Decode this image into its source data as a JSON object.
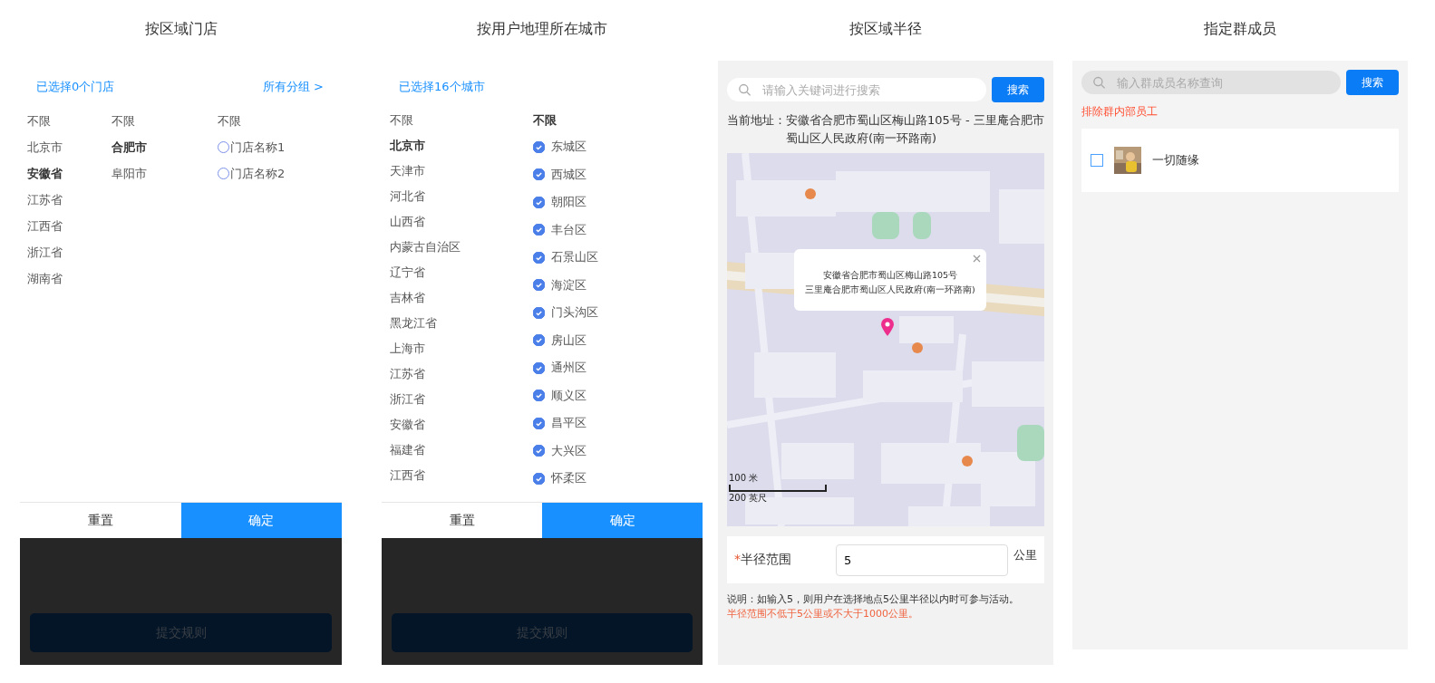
{
  "panels": [
    {
      "title": "按区域门店",
      "kind": "store",
      "selected_text": "已选择0个门店",
      "group_link": "所有分组 >",
      "columns": [
        {
          "items": [
            {
              "label": "不限",
              "selected": false
            },
            {
              "label": "北京市",
              "selected": false
            },
            {
              "label": "安徽省",
              "selected": true
            },
            {
              "label": "江苏省",
              "selected": false
            },
            {
              "label": "江西省",
              "selected": false
            },
            {
              "label": "浙江省",
              "selected": false
            },
            {
              "label": "湖南省",
              "selected": false
            }
          ]
        },
        {
          "items": [
            {
              "label": "不限",
              "selected": false
            },
            {
              "label": "合肥市",
              "selected": true
            },
            {
              "label": "阜阳市",
              "selected": false
            }
          ]
        }
      ],
      "stores": {
        "header": "不限",
        "items": [
          {
            "label": "门店名称1",
            "checked": false
          },
          {
            "label": "门店名称2",
            "checked": false
          }
        ]
      },
      "reset": "重置",
      "confirm": "确定",
      "submit": "提交规则"
    },
    {
      "title": "按用户地理所在城市",
      "kind": "city",
      "selected_text": "已选择16个城市",
      "provinces": [
        {
          "label": "不限",
          "selected": false
        },
        {
          "label": "北京市",
          "selected": true
        },
        {
          "label": "天津市",
          "selected": false
        },
        {
          "label": "河北省",
          "selected": false
        },
        {
          "label": "山西省",
          "selected": false
        },
        {
          "label": "内蒙古自治区",
          "selected": false
        },
        {
          "label": "辽宁省",
          "selected": false
        },
        {
          "label": "吉林省",
          "selected": false
        },
        {
          "label": "黑龙江省",
          "selected": false
        },
        {
          "label": "上海市",
          "selected": false
        },
        {
          "label": "江苏省",
          "selected": false
        },
        {
          "label": "浙江省",
          "selected": false
        },
        {
          "label": "安徽省",
          "selected": false
        },
        {
          "label": "福建省",
          "selected": false
        },
        {
          "label": "江西省",
          "selected": false
        }
      ],
      "districts_header": {
        "label": "不限",
        "selected": true
      },
      "districts": [
        {
          "label": "东城区",
          "checked": true
        },
        {
          "label": "西城区",
          "checked": true
        },
        {
          "label": "朝阳区",
          "checked": true
        },
        {
          "label": "丰台区",
          "checked": true
        },
        {
          "label": "石景山区",
          "checked": true
        },
        {
          "label": "海淀区",
          "checked": true
        },
        {
          "label": "门头沟区",
          "checked": true
        },
        {
          "label": "房山区",
          "checked": true
        },
        {
          "label": "通州区",
          "checked": true
        },
        {
          "label": "顺义区",
          "checked": true
        },
        {
          "label": "昌平区",
          "checked": true
        },
        {
          "label": "大兴区",
          "checked": true
        },
        {
          "label": "怀柔区",
          "checked": true
        }
      ],
      "reset": "重置",
      "confirm": "确定",
      "submit": "提交规则"
    },
    {
      "title": "按区域半径",
      "kind": "radius",
      "search": {
        "placeholder": "请输入关键词进行搜索",
        "button": "搜索"
      },
      "address_label": "当前地址：",
      "address": "安徽省合肥市蜀山区梅山路105号 - 三里庵合肥市蜀山区人民政府(南一环路南)",
      "map": {
        "kind": "picture",
        "popup": [
          "安徽省合肥市蜀山区梅山路105号",
          "三里庵合肥市蜀山区人民政府(南一环路南)"
        ],
        "scale": [
          "100 米",
          "200 英尺"
        ]
      },
      "radius": {
        "required_mark": "*",
        "label": "半径范围",
        "value": "5",
        "unit": "公里"
      },
      "note": "说明：如输入5，则用户在选择地点5公里半径以内时可参与活动。",
      "warning": "半径范围不低于5公里或不大于1000公里。"
    },
    {
      "title": "指定群成员",
      "kind": "members",
      "search": {
        "placeholder": "输入群成员名称查询",
        "button": "搜索"
      },
      "exclude_text": "排除群内部员工",
      "members": [
        {
          "name": "一切随缘",
          "checked": false
        }
      ]
    }
  ]
}
